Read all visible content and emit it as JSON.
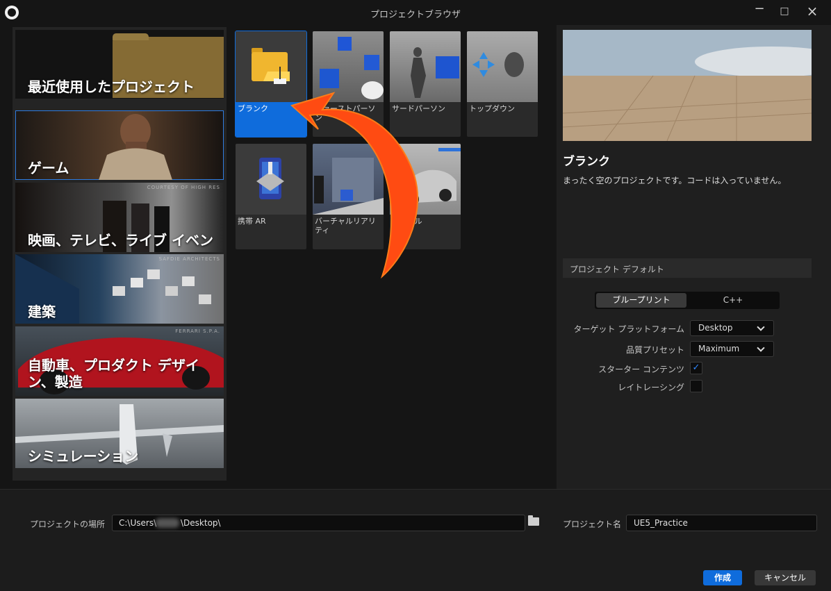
{
  "window": {
    "title": "プロジェクトブラウザ"
  },
  "categories": [
    {
      "label": "最近使用したプロジェクト"
    },
    {
      "label": "ゲーム",
      "selected": true
    },
    {
      "label": "映画、テレビ、ライブ イベント",
      "credit": "COURTESY OF HIGH RES"
    },
    {
      "label": "建築",
      "credit": "SAFDIE ARCHITECTS"
    },
    {
      "label": "自動車、プロダクト デザイン、製造",
      "credit": "FERRARI S.P.A."
    },
    {
      "label": "シミュレーション"
    }
  ],
  "templates": [
    {
      "label": "ブランク",
      "selected": true
    },
    {
      "label": "ファーストパーソン"
    },
    {
      "label": "サードパーソン"
    },
    {
      "label": "トップダウン"
    },
    {
      "label": "携帯 AR"
    },
    {
      "label": "バーチャルリアリティ"
    },
    {
      "label": "ビークル"
    }
  ],
  "details": {
    "name": "ブランク",
    "description": "まったく空のプロジェクトです。コードは入っていません。",
    "section": "プロジェクト デフォルト",
    "type_options": [
      "ブループリント",
      "C++"
    ],
    "selected_type": "ブループリント",
    "target_platform": {
      "label": "ターゲット プラットフォーム",
      "value": "Desktop"
    },
    "quality_preset": {
      "label": "品質プリセット",
      "value": "Maximum"
    },
    "starter_content": {
      "label": "スターター コンテンツ",
      "checked": true
    },
    "raytracing": {
      "label": "レイトレーシング",
      "checked": false
    }
  },
  "footer": {
    "location_label": "プロジェクトの場所",
    "location_prefix": "C:\\Users\\",
    "location_suffix": "\\Desktop\\",
    "name_label": "プロジェクト名",
    "project_name": "UE5_Practice",
    "create": "作成",
    "cancel": "キャンセル"
  },
  "colors": {
    "accent": "#0f6cdc",
    "arrow": "#ff4b12"
  },
  "icons": {
    "logo": "unreal-logo-icon",
    "folder": "folder-icon",
    "check": "checkmark-icon"
  }
}
